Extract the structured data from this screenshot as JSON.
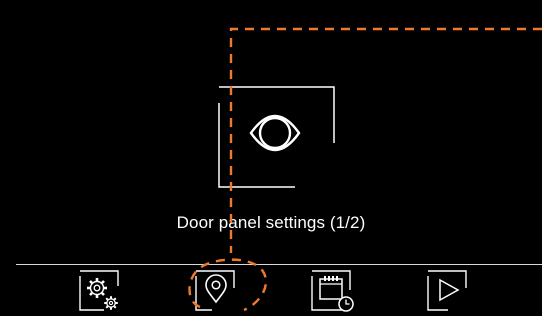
{
  "screen": {
    "title": "Door panel settings (1/2)",
    "main_icon": "eye-icon"
  },
  "bottom_nav": {
    "items": [
      {
        "icon": "settings-gears-icon",
        "state": "normal"
      },
      {
        "icon": "location-pin-icon",
        "state": "highlighted"
      },
      {
        "icon": "calendar-clock-icon",
        "state": "normal"
      },
      {
        "icon": "play-triangle-icon",
        "state": "normal"
      }
    ]
  },
  "colors": {
    "background": "#000000",
    "foreground": "#ffffff",
    "highlight": "#f07a2a"
  }
}
